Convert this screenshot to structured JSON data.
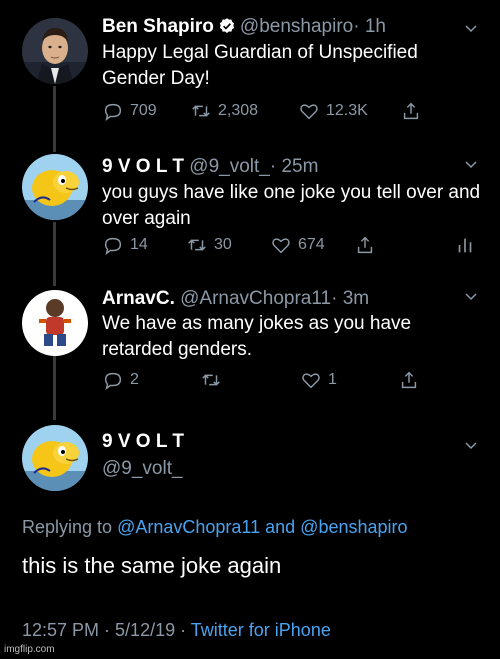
{
  "tweets": [
    {
      "name": "Ben Shapiro",
      "handle": "@benshapiro",
      "time": "· 1h",
      "text": "Happy Legal Guardian of Unspecified Gender Day!",
      "reply_count": "709",
      "retweet_count": "2,308",
      "like_count": "12.3K"
    },
    {
      "name": "9 V O L T",
      "handle": "@9_volt_",
      "time": "· 25m",
      "text": "you guys have like one joke you tell over and over again",
      "reply_count": "14",
      "retweet_count": "30",
      "like_count": "674"
    },
    {
      "name": "ArnavC.",
      "handle": "@ArnavChopra11",
      "time": "· 3m",
      "text": "We have as many jokes as you have retarded genders.",
      "reply_count": "2",
      "retweet_count": "",
      "like_count": "1"
    }
  ],
  "main_tweet": {
    "name": "9 V O L T",
    "handle": "@9_volt_",
    "replying_prefix": "Replying to",
    "reply_user_1": "@ArnavChopra11",
    "reply_and": "and",
    "reply_user_2": "@benshapiro",
    "text": "this is the same joke again",
    "timestamp": "12:57 PM · 5/12/19 ·",
    "source": "Twitter for iPhone"
  },
  "watermark": "imgflip.com",
  "colors": {
    "background": "#000000",
    "muted": "#8b98a5",
    "link": "#4aa3f0",
    "verified": "#ffffff"
  },
  "icons": [
    "reply-icon",
    "retweet-icon",
    "like-icon",
    "share-icon",
    "analytics-icon",
    "chevron-down-icon",
    "verified-badge-icon"
  ]
}
